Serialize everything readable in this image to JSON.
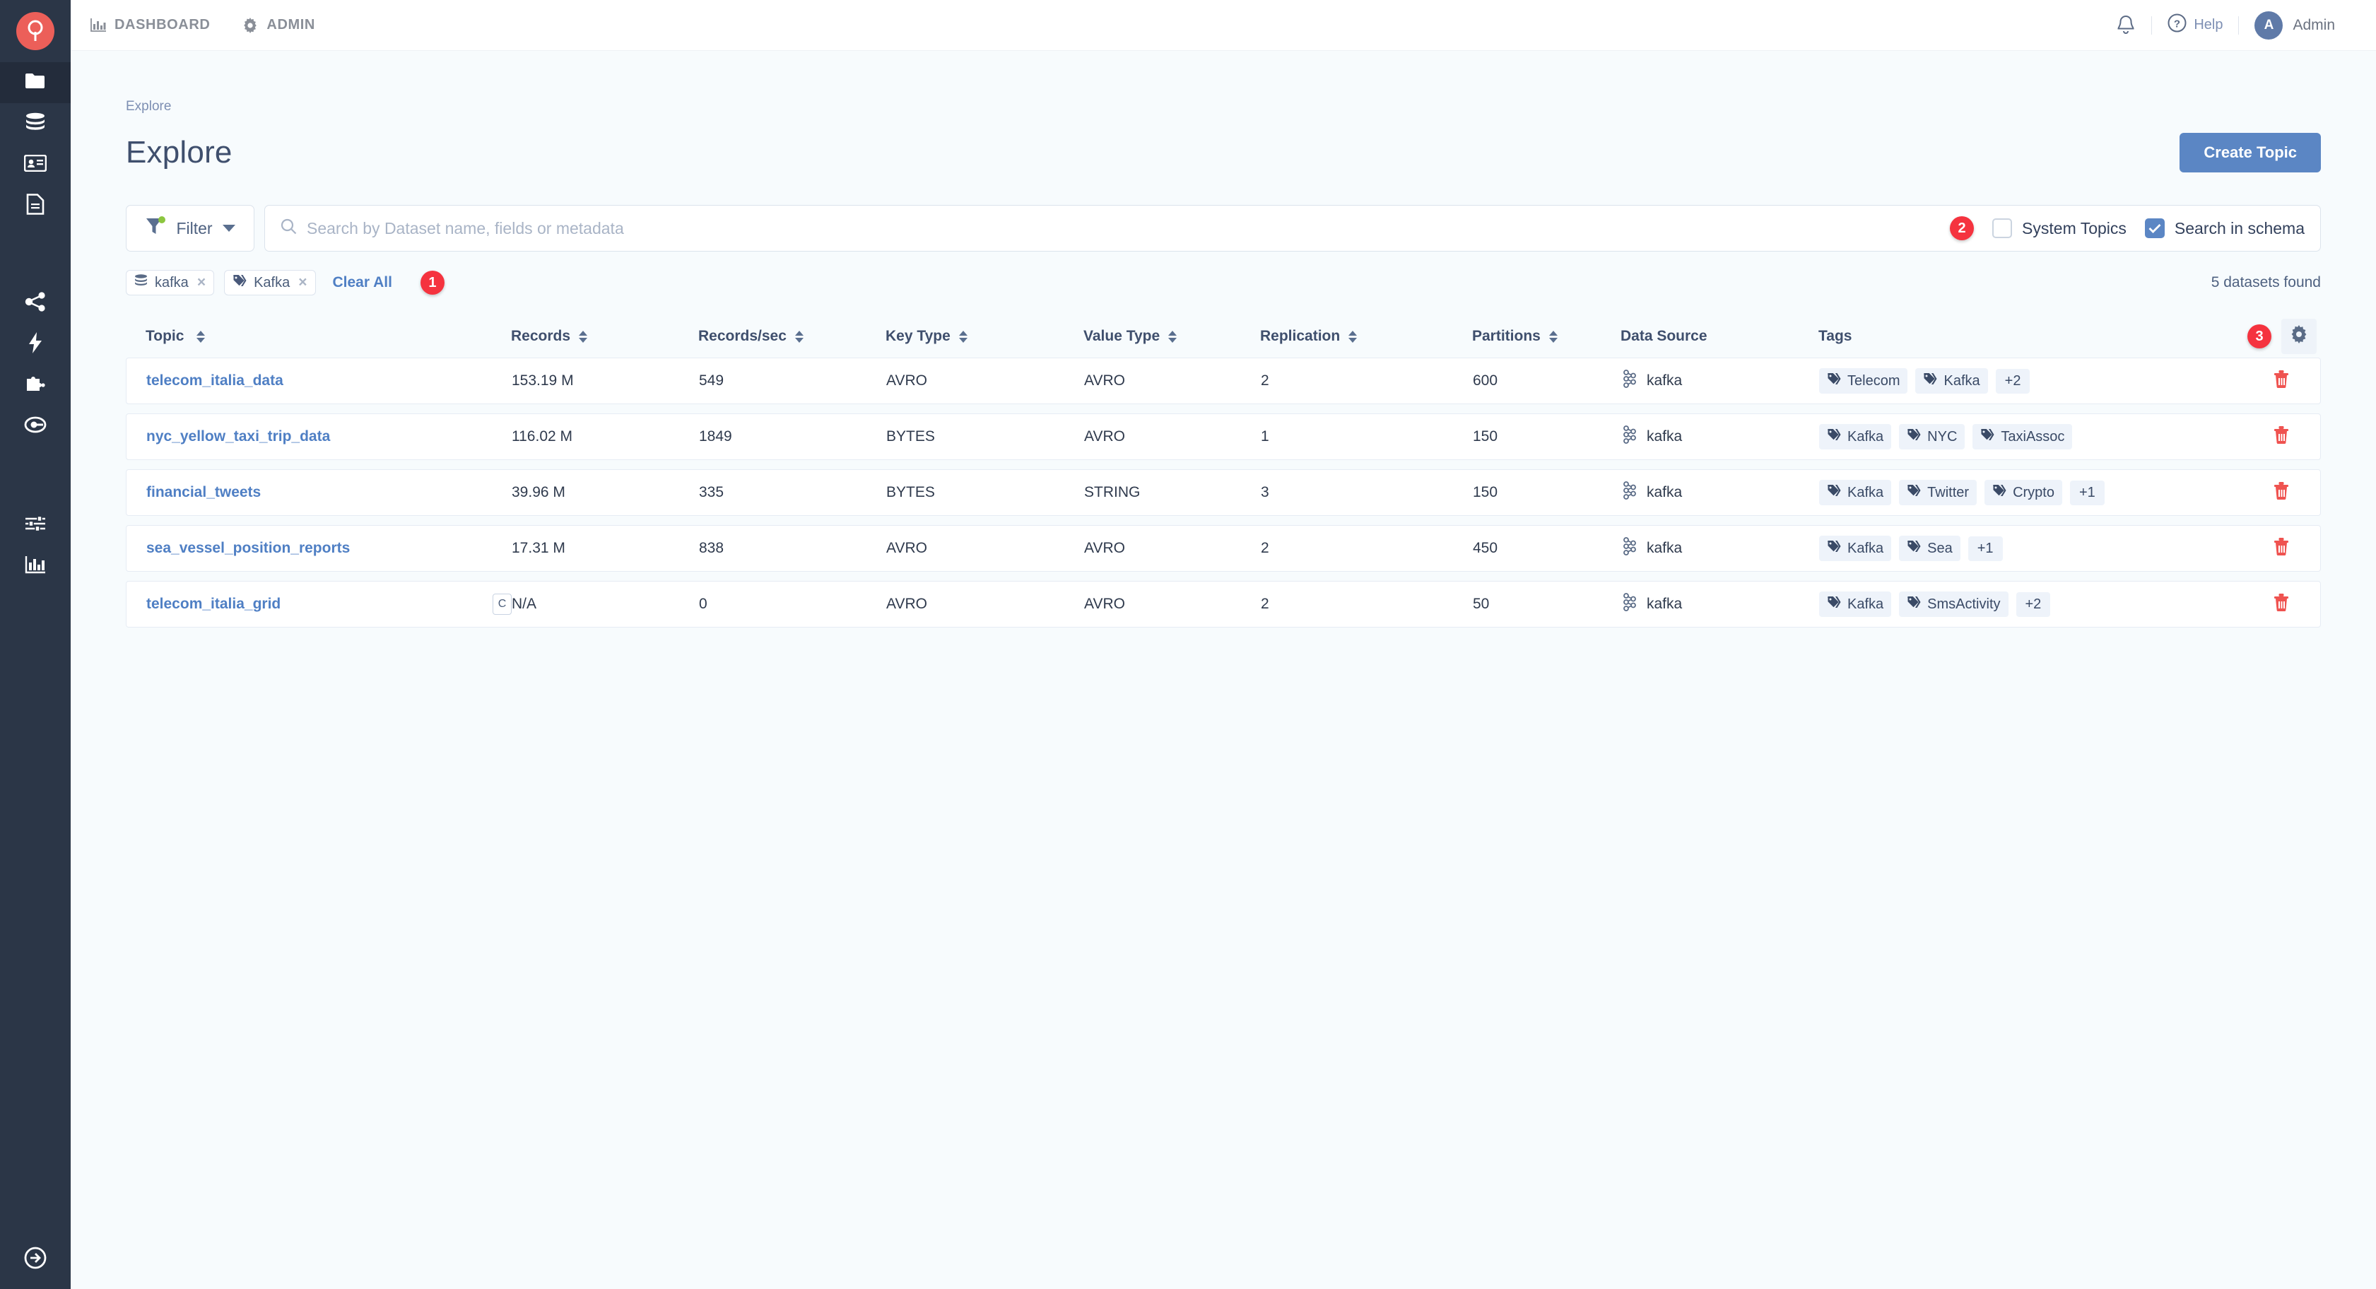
{
  "brand": {
    "accent": "#ec5f59",
    "primary": "#5b86c4",
    "danger": "#f5333f"
  },
  "topbar": {
    "nav": [
      {
        "label": "DASHBOARD",
        "icon": "bar-chart-icon"
      },
      {
        "label": "ADMIN",
        "icon": "gear-icon"
      }
    ],
    "bell_icon": "bell-icon",
    "help_label": "Help",
    "help_icon": "question-circle-icon",
    "avatar_initial": "A",
    "user_name": "Admin"
  },
  "sidebar": {
    "items": [
      {
        "name": "folder-icon",
        "active": true
      },
      {
        "name": "database-icon",
        "active": false
      },
      {
        "name": "id-card-icon",
        "active": false
      },
      {
        "name": "document-icon",
        "active": false
      },
      {
        "name": "share-icon",
        "active": false
      },
      {
        "name": "bolt-icon",
        "active": false
      },
      {
        "name": "puzzle-icon",
        "active": false
      },
      {
        "name": "target-icon",
        "active": false
      },
      {
        "name": "sliders-icon",
        "active": false
      },
      {
        "name": "chart-icon",
        "active": false
      }
    ],
    "bottom_item": {
      "name": "arrow-circle-right-icon"
    }
  },
  "page": {
    "breadcrumb": "Explore",
    "title": "Explore",
    "create_button": "Create Topic",
    "results_text": "5 datasets found"
  },
  "toolbar": {
    "filter_label": "Filter",
    "filter_has_active_dot": true,
    "search_placeholder": "Search by Dataset name, fields or metadata",
    "search_value": "",
    "options": [
      {
        "label": "System Topics",
        "checked": false
      },
      {
        "label": "Search in schema",
        "checked": true
      }
    ],
    "annotation_badge_2": "2"
  },
  "chips": {
    "items": [
      {
        "label": "kafka",
        "icon": "database-icon",
        "remove": "×"
      },
      {
        "label": "Kafka",
        "icon": "tag-icon",
        "remove": "×"
      }
    ],
    "clear_all": "Clear All",
    "annotation_badge_1": "1"
  },
  "table": {
    "annotation_badge_3": "3",
    "settings_icon": "gear-icon",
    "columns": [
      {
        "label": "Topic",
        "sortable": true
      },
      {
        "label": "Records",
        "sortable": true
      },
      {
        "label": "Records/sec",
        "sortable": true
      },
      {
        "label": "Key Type",
        "sortable": true
      },
      {
        "label": "Value Type",
        "sortable": true
      },
      {
        "label": "Replication",
        "sortable": true
      },
      {
        "label": "Partitions",
        "sortable": true
      },
      {
        "label": "Data Source",
        "sortable": false
      },
      {
        "label": "Tags",
        "sortable": false
      }
    ],
    "rows": [
      {
        "topic": "telecom_italia_data",
        "compact_badge": "",
        "records": "153.19 M",
        "records_sec": "549",
        "key_type": "AVRO",
        "value_type": "AVRO",
        "replication": "2",
        "partitions": "600",
        "data_source": "kafka",
        "tags": [
          "Telecom",
          "Kafka"
        ],
        "tags_more": "+2",
        "delete_icon": "trash-icon"
      },
      {
        "topic": "nyc_yellow_taxi_trip_data",
        "compact_badge": "",
        "records": "116.02 M",
        "records_sec": "1849",
        "key_type": "BYTES",
        "value_type": "AVRO",
        "replication": "1",
        "partitions": "150",
        "data_source": "kafka",
        "tags": [
          "Kafka",
          "NYC",
          "TaxiAssoc"
        ],
        "tags_more": "",
        "delete_icon": "trash-icon"
      },
      {
        "topic": "financial_tweets",
        "compact_badge": "",
        "records": "39.96 M",
        "records_sec": "335",
        "key_type": "BYTES",
        "value_type": "STRING",
        "replication": "3",
        "partitions": "150",
        "data_source": "kafka",
        "tags": [
          "Kafka",
          "Twitter",
          "Crypto"
        ],
        "tags_more": "+1",
        "delete_icon": "trash-icon"
      },
      {
        "topic": "sea_vessel_position_reports",
        "compact_badge": "",
        "records": "17.31 M",
        "records_sec": "838",
        "key_type": "AVRO",
        "value_type": "AVRO",
        "replication": "2",
        "partitions": "450",
        "data_source": "kafka",
        "tags": [
          "Kafka",
          "Sea"
        ],
        "tags_more": "+1",
        "delete_icon": "trash-icon"
      },
      {
        "topic": "telecom_italia_grid",
        "compact_badge": "C",
        "records": "N/A",
        "records_sec": "0",
        "key_type": "AVRO",
        "value_type": "AVRO",
        "replication": "2",
        "partitions": "50",
        "data_source": "kafka",
        "tags": [
          "Kafka",
          "SmsActivity"
        ],
        "tags_more": "+2",
        "delete_icon": "trash-icon"
      }
    ]
  }
}
